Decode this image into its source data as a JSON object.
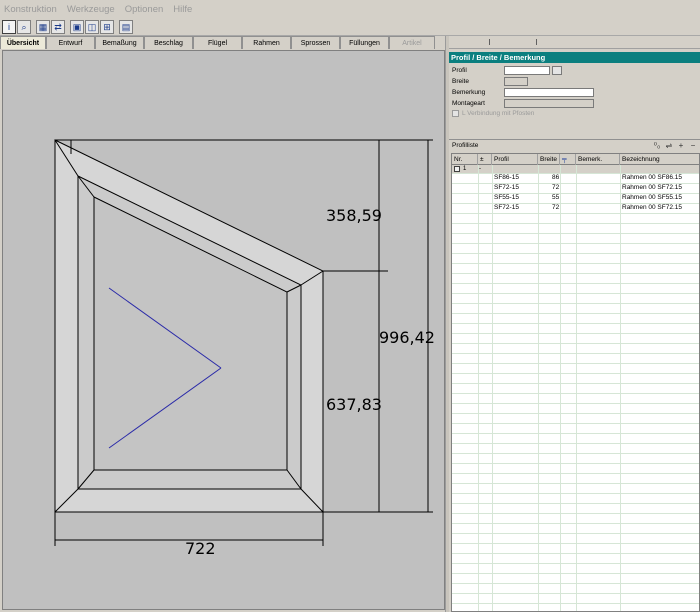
{
  "menu": [
    "Konstruktion",
    "Werkzeuge",
    "Optionen",
    "Hilfe"
  ],
  "toolbar_icons": [
    "info-icon",
    "zoom-icon",
    "layout-icon",
    "mirror-icon",
    "frame-icon",
    "window-icon",
    "grid-icon",
    "save-icon"
  ],
  "tabs": [
    {
      "label": "Übersicht",
      "state": "active"
    },
    {
      "label": "Entwurf",
      "state": "normal"
    },
    {
      "label": "Bemaßung",
      "state": "normal"
    },
    {
      "label": "Beschlag",
      "state": "normal"
    },
    {
      "label": "Flügel",
      "state": "normal"
    },
    {
      "label": "Rahmen",
      "state": "normal"
    },
    {
      "label": "Sprossen",
      "state": "normal"
    },
    {
      "label": "Füllungen",
      "state": "normal"
    },
    {
      "label": "Artikel",
      "state": "disabled"
    }
  ],
  "dimensions": {
    "upper": "358,59",
    "total": "996,42",
    "lower": "637,83",
    "width": "722"
  },
  "panel": {
    "title": "Profil / Breite / Bemerkung",
    "fields": {
      "profil": "Profil",
      "breite": "Breite",
      "bemerkung": "Bemerkung",
      "montageart": "Montageart"
    },
    "checkbox": "L Verbindung mit Pfosten"
  },
  "profilliste": {
    "title": "Profilliste",
    "columns": [
      "Nr.",
      "±",
      "Profil",
      "Breite",
      "",
      "Bemerk.",
      "Bezeichnung"
    ],
    "group": {
      "nr": "1",
      "sign": "-"
    },
    "rows": [
      {
        "profil": "SF86-15",
        "breite": "86",
        "bezeichnung": "Rahmen 00 SF86.15"
      },
      {
        "profil": "SF72-15",
        "breite": "72",
        "bezeichnung": "Rahmen 00 SF72.15"
      },
      {
        "profil": "SF55-15",
        "breite": "55",
        "bezeichnung": "Rahmen 00 SF55.15"
      },
      {
        "profil": "SF72-15",
        "breite": "72",
        "bezeichnung": "Rahmen 00 SF72.15"
      }
    ]
  },
  "colors": {
    "title_bar": "#0b7f7f",
    "canvas": "#c0c0c0",
    "opening_line": "#2a2aa8"
  }
}
